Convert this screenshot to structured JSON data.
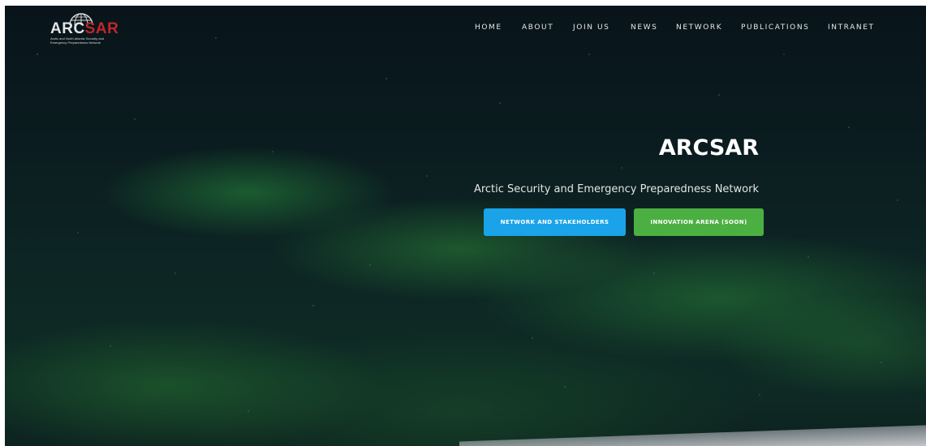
{
  "header": {
    "logo": {
      "word_part1": "ARC",
      "word_part2": "SAR",
      "tagline": "Arctic and North Atlantic Security and Emergency Preparedness Network",
      "brand_colors": {
        "arc": "#e4e4e4",
        "sar": "#c0262a"
      }
    },
    "nav": {
      "items": [
        {
          "label": "HOME"
        },
        {
          "label": "ABOUT"
        },
        {
          "label": "JOIN US"
        },
        {
          "label": "NEWS"
        },
        {
          "label": "NETWORK"
        },
        {
          "label": "PUBLICATIONS"
        },
        {
          "label": "INTRANET"
        }
      ]
    }
  },
  "hero": {
    "title": "ARCSAR",
    "subtitle": "Arctic Security and Emergency Preparedness Network",
    "buttons": [
      {
        "label": "NETWORK AND STAKEHOLDERS",
        "color": "#1aa3e8"
      },
      {
        "label": "INNOVATION ARENA (SOON)",
        "color": "#4caf42"
      }
    ]
  }
}
